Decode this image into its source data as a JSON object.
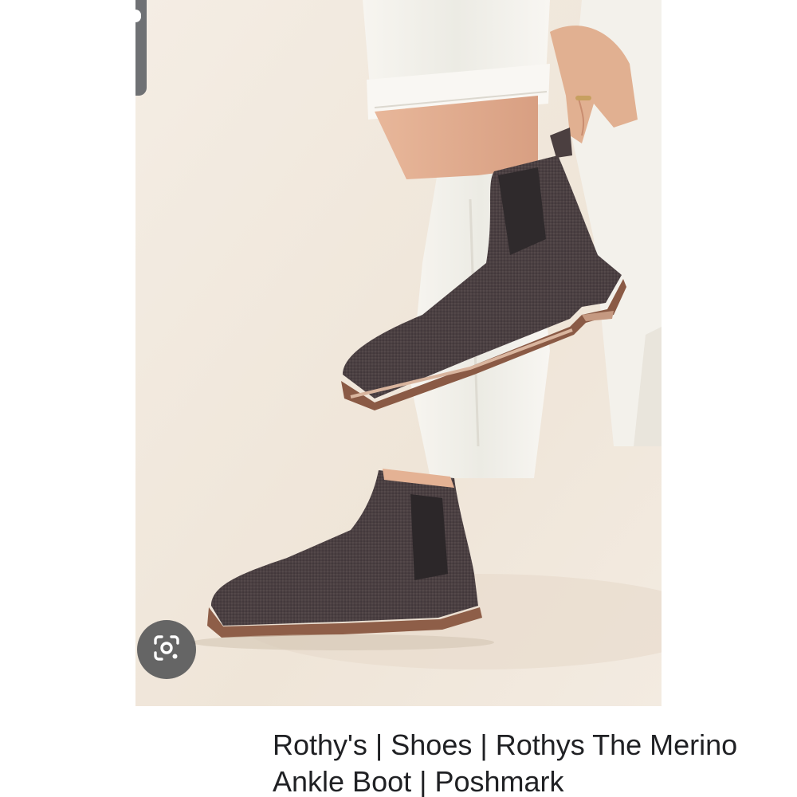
{
  "result": {
    "title": "Rothy's | Shoes | Rothys The Merino Ankle Boot | Poshmark",
    "image_subject": "Rothy's The Merino Ankle Boot, charcoal knit chelsea boots with brown soles"
  },
  "icons": {
    "lens": "google-lens-icon",
    "tab_marker": "indicator-dot"
  },
  "colors": {
    "photo_background": "#f1e9df",
    "boot_body": "#4a3f40",
    "boot_sole": "#8a5a45",
    "caption_text": "#202124",
    "lens_button_bg": "#4e4f52"
  }
}
